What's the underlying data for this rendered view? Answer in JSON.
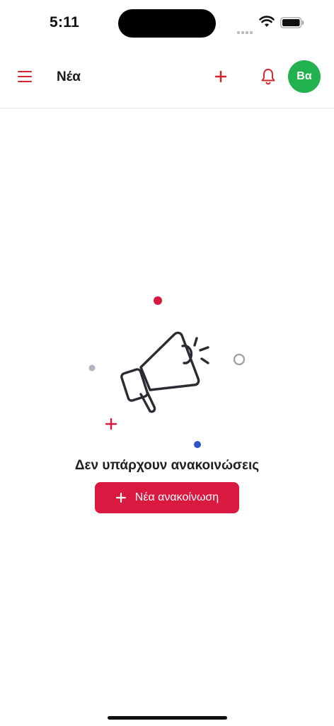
{
  "status_bar": {
    "time": "5:11"
  },
  "header": {
    "title": "Νέα",
    "avatar_initials": "Βα",
    "accent_color": "#d2232f",
    "avatar_color": "#21b14f"
  },
  "empty_state": {
    "message": "Δεν υπάρχουν ανακοινώσεις",
    "button_label": "Νέα ανακοίνωση",
    "button_color": "#d9193f"
  },
  "icons": [
    "menu-icon",
    "plus-icon",
    "bell-icon",
    "megaphone-icon",
    "wifi-icon",
    "battery-icon"
  ]
}
